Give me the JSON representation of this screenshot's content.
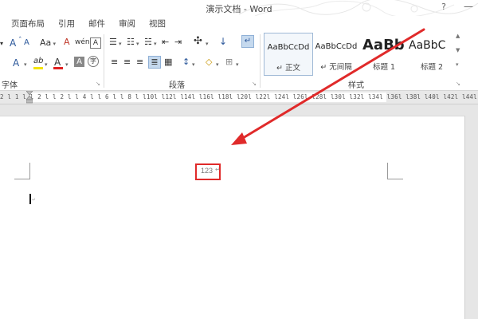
{
  "window": {
    "title": "演示文档 - Word",
    "help_glyph": "?",
    "minimize_glyph": "—"
  },
  "tabs": [
    {
      "label": "页面布局"
    },
    {
      "label": "引用"
    },
    {
      "label": "邮件"
    },
    {
      "label": "审阅"
    },
    {
      "label": "视图"
    }
  ],
  "ribbon": {
    "groups": {
      "font_label": "字体",
      "paragraph_label": "段落",
      "styles_label": "样式"
    },
    "font": {
      "grow_glyph": "A",
      "shrink_glyph": "ˇ",
      "case_label": "Aa",
      "clear_format_glyph": "A",
      "phonetic_label": "wén",
      "char_border_glyph": "A",
      "text_effect_glyph": "A",
      "highlight_label": "ab",
      "font_color_glyph": "A",
      "char_shading_glyph": "A",
      "enclose_glyph": "字"
    },
    "paragraph": {
      "bullets_glyph": "☰",
      "numbering_glyph": "☷",
      "multilevel_glyph": "☵",
      "decrease_indent_glyph": "⇤",
      "increase_indent_glyph": "⇥",
      "chinese_layout_glyph": "✣",
      "sort_glyph": "↓",
      "show_marks_glyph": "↵",
      "align_left_glyph": "≡",
      "align_center_glyph": "≡",
      "align_right_glyph": "≡",
      "justify_glyph": "≣",
      "distributed_glyph": "▦",
      "line_spacing_glyph": "↕",
      "shading_glyph": "◇",
      "borders_glyph": "⊞"
    },
    "styles": [
      {
        "sample": "AaBbCcDd",
        "name": "↵ 正文",
        "active": true
      },
      {
        "sample": "AaBbCcDd",
        "name": "↵ 无间隔",
        "active": false
      },
      {
        "sample": "AaBb",
        "name": "标题 1",
        "active": false
      },
      {
        "sample": "AaBbC",
        "name": "标题 2",
        "active": false
      }
    ],
    "launcher_glyph": "↘",
    "gallery_up": "▲",
    "gallery_down": "▼",
    "gallery_more": "▾"
  },
  "ruler": {
    "ticks": "2 l 1 l   l 2 l   l 2 l   l 4 l   l 6 l   l 8 l   l10l   l12l   l14l   l16l   l18l   l20l   l22l   l24l   l26l   l28l   l30l   l32l   l34l   l36l   l38l   l40l   l42l   l44l   l46l   l48l"
  },
  "document": {
    "header_text": "123",
    "header_mark": "↵",
    "para_mark": "↵"
  },
  "annotation": {
    "box_color": "#e02a2a",
    "arrow_color": "#e02a2a"
  },
  "colors": {
    "accent": "#2b579a",
    "font_color_bar": "#e02020",
    "highlight_bar": "#f4e400"
  }
}
